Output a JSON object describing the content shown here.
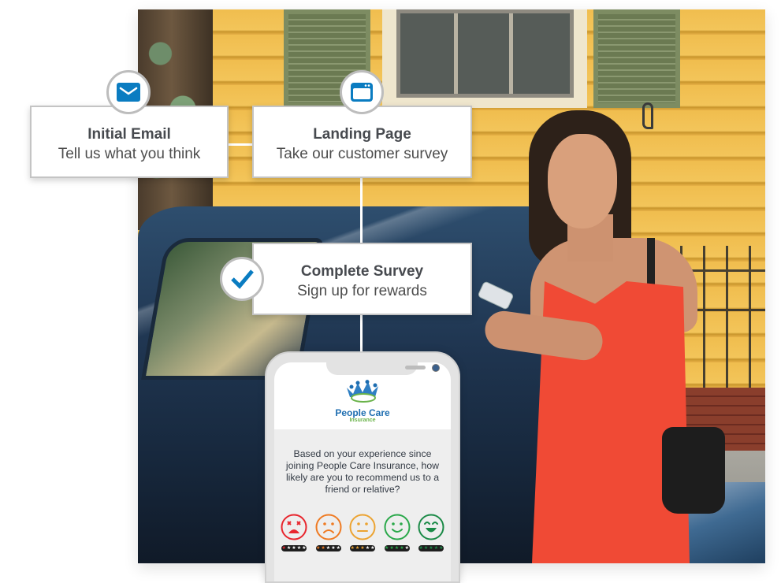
{
  "steps": [
    {
      "icon": "envelope-icon",
      "title": "Initial Email",
      "subtitle": "Tell us what you think"
    },
    {
      "icon": "browser-window-icon",
      "title": "Landing Page",
      "subtitle": "Take our customer survey"
    },
    {
      "icon": "checkmark-icon",
      "title": "Complete Survey",
      "subtitle": "Sign up for rewards"
    }
  ],
  "colors": {
    "icon_blue": "#0a7cc1",
    "card_border": "#c4c4c4",
    "brand_blue": "#1d6db0",
    "brand_green": "#6ab34a"
  },
  "phone": {
    "brand_name": "People Care",
    "brand_tagline": "Insurance",
    "question": "Based on your experience since joining People Care Insurance, how likely are you to recommend us to a friend or relative?",
    "ratings": [
      {
        "name": "very-unhappy",
        "color": "#e8262e",
        "stars": 1,
        "star_color": "#e8262e"
      },
      {
        "name": "unhappy",
        "color": "#ef7a22",
        "stars": 2,
        "star_color": "#ef7a22"
      },
      {
        "name": "neutral",
        "color": "#eca331",
        "stars": 3,
        "star_color": "#eca331"
      },
      {
        "name": "happy",
        "color": "#2aa84a",
        "stars": 4,
        "star_color": "#2aa84a"
      },
      {
        "name": "very-happy",
        "color": "#1b8a47",
        "stars": 5,
        "star_color": "#1b8a47"
      }
    ]
  }
}
